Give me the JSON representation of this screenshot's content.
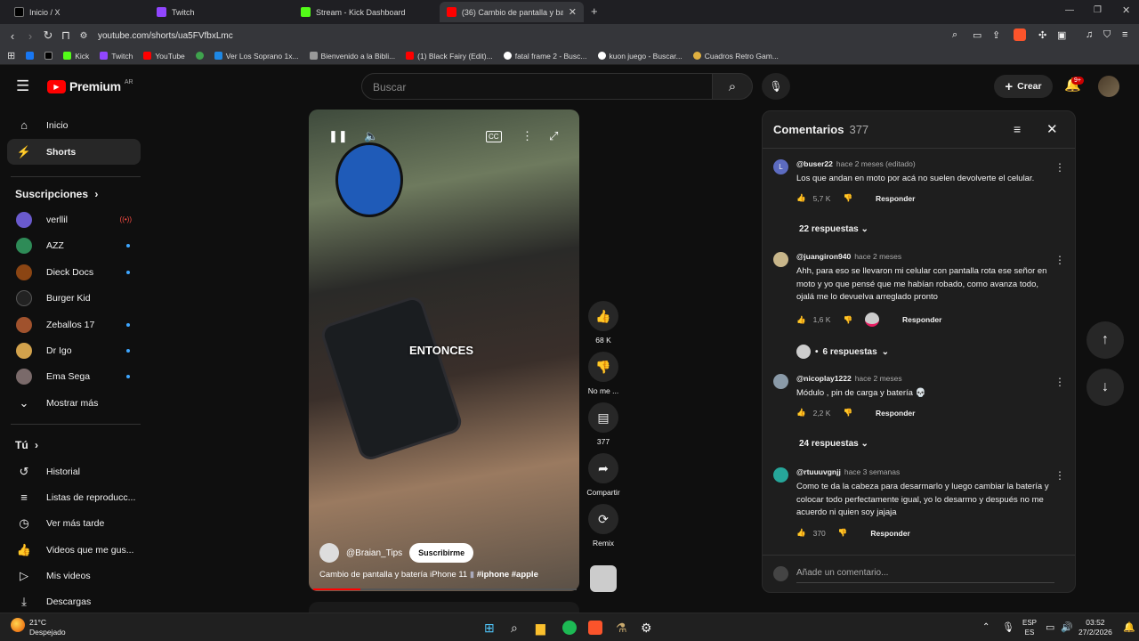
{
  "browser": {
    "tabs": [
      {
        "label": "Inicio / X",
        "color": "#000000"
      },
      {
        "label": "Twitch",
        "color": "#9146ff"
      },
      {
        "label": "Stream - Kick Dashboard",
        "color": "#53fc18"
      },
      {
        "label": "(36) Cambio de pantalla y bat",
        "color": "#ff0000"
      }
    ],
    "url": "youtube.com/shorts/ua5FVfbxLmc",
    "bookmarks": [
      {
        "label": "",
        "color": "#1877f2"
      },
      {
        "label": "",
        "color": "#000000"
      },
      {
        "label": "Kick",
        "color": "#53fc18"
      },
      {
        "label": "Twitch",
        "color": "#9146ff"
      },
      {
        "label": "YouTube",
        "color": "#ff0000"
      },
      {
        "label": "",
        "color": "#3fa34d"
      },
      {
        "label": "Ver Los Soprano 1x...",
        "color": "#1e88e5"
      },
      {
        "label": "Bienvenido a la Bibli...",
        "color": "#999999"
      },
      {
        "label": "(1) Black Fairy (Edit)...",
        "color": "#ff0000"
      },
      {
        "label": "fatal frame 2 - Busc...",
        "color": "#ffffff"
      },
      {
        "label": "kuon juego - Buscar...",
        "color": "#ffffff"
      },
      {
        "label": "Cuadros Retro Gam...",
        "color": "#e0b040"
      }
    ]
  },
  "youtube": {
    "logo": "Premium",
    "region": "AR",
    "search_placeholder": "Buscar",
    "create_label": "Crear",
    "notifications": "9+"
  },
  "sidebar": {
    "main": [
      {
        "label": "Inicio",
        "icon": "⌂"
      },
      {
        "label": "Shorts",
        "icon": "▶"
      }
    ],
    "subs_title": "Suscripciones",
    "subs": [
      {
        "label": "verllil",
        "color": "#6a5acd",
        "live": true
      },
      {
        "label": "AZZ",
        "color": "#2e8b57",
        "dot": true
      },
      {
        "label": "Dieck Docs",
        "color": "#8b4513",
        "dot": true
      },
      {
        "label": "Burger Kid",
        "color": "#222222",
        "dot": false
      },
      {
        "label": "Zeballos 17",
        "color": "#a0522d",
        "dot": true
      },
      {
        "label": "Dr Igo",
        "color": "#d2a24c",
        "dot": true
      },
      {
        "label": "Ema Sega",
        "color": "#7a6a6a",
        "dot": true
      }
    ],
    "show_more": "Mostrar más",
    "you_title": "Tú",
    "you": [
      {
        "label": "Historial",
        "icon": "↺"
      },
      {
        "label": "Listas de reproducc...",
        "icon": "≡"
      },
      {
        "label": "Ver más tarde",
        "icon": "◷"
      },
      {
        "label": "Videos que me gus...",
        "icon": "👍"
      },
      {
        "label": "Mis videos",
        "icon": "▷"
      },
      {
        "label": "Descargas",
        "icon": "⤓"
      }
    ]
  },
  "video": {
    "overlay_text": "ENTONCES",
    "channel": "@Braian_Tips",
    "subscribe": "Suscribirme",
    "title": "Cambio de pantalla y batería iPhone 11",
    "hashtags": "#iphone #apple",
    "progress": 0.18,
    "actions": {
      "likes": "68 K",
      "dislike": "No me ...",
      "comments": "377",
      "share": "Compartir",
      "remix": "Remix"
    }
  },
  "comments": {
    "title": "Comentarios",
    "count": "377",
    "items": [
      {
        "user": "@buser22",
        "time": "hace 2 meses (editado)",
        "text": "Los que andan en moto por acá no suelen devolverte el celular.",
        "likes": "5,7 K",
        "reply": "Responder",
        "replies": "22 respuestas",
        "color": "#5c6bc0",
        "initial": "L"
      },
      {
        "user": "@juangiron940",
        "time": "hace 2 meses",
        "text": "Ahh, para eso se llevaron mi celular con pantalla rota ese señor en moto y yo que pensé que me habían robado, como avanza todo, ojalá me lo devuelva arreglado pronto",
        "likes": "1,6 K",
        "reply": "Responder",
        "replies": "6 respuestas",
        "color": "#c8b68a",
        "initial": ""
      },
      {
        "user": "@nicoplay1222",
        "time": "hace 2 meses",
        "text": "Módulo , pin de carga y batería 💀",
        "likes": "2,2 K",
        "reply": "Responder",
        "replies": "24 respuestas",
        "color": "#8a9aa8",
        "initial": ""
      },
      {
        "user": "@rtuuuvgnjj",
        "time": "hace 3 semanas",
        "text": "Como te da la cabeza para desarmarlo y luego cambiar la batería y colocar todo perfectamente igual, yo lo desarmo y después no me acuerdo ni quien soy jajaja",
        "likes": "370",
        "reply": "Responder",
        "color": "#26a69a",
        "initial": ""
      }
    ],
    "add_placeholder": "Añade un comentario..."
  },
  "taskbar": {
    "temp": "21°C",
    "weather": "Despejado",
    "lang1": "ESP",
    "lang2": "ES",
    "time": "03:52",
    "date": "27/2/2026"
  }
}
